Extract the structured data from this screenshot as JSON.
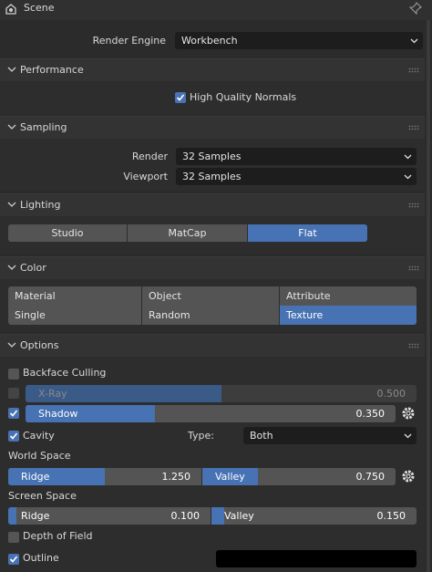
{
  "header": {
    "title": "Scene"
  },
  "render_engine": {
    "label": "Render Engine",
    "value": "Workbench"
  },
  "performance": {
    "title": "Performance",
    "high_quality_normals": {
      "label": "High Quality Normals",
      "checked": true
    }
  },
  "sampling": {
    "title": "Sampling",
    "render": {
      "label": "Render",
      "value": "32 Samples"
    },
    "viewport": {
      "label": "Viewport",
      "value": "32 Samples"
    }
  },
  "lighting": {
    "title": "Lighting",
    "options": [
      "Studio",
      "MatCap",
      "Flat"
    ],
    "selected": "Flat"
  },
  "color": {
    "title": "Color",
    "row1": [
      "Material",
      "Object",
      "Attribute"
    ],
    "row2": [
      "Single",
      "Random",
      "Texture"
    ],
    "selected": "Texture"
  },
  "options": {
    "title": "Options",
    "backface_culling": {
      "label": "Backface Culling",
      "checked": false
    },
    "xray": {
      "label": "X-Ray",
      "value": "0.500",
      "fraction": 0.5,
      "enabled": false
    },
    "shadow": {
      "label": "Shadow",
      "value": "0.350",
      "fraction": 0.35,
      "enabled": true
    },
    "cavity": {
      "label": "Cavity",
      "checked": true,
      "type_label": "Type:",
      "type_value": "Both"
    },
    "world_space": {
      "label": "World Space",
      "ridge": {
        "label": "Ridge",
        "value": "1.250",
        "fraction": 0.5
      },
      "valley": {
        "label": "Valley",
        "value": "0.750",
        "fraction": 0.29
      }
    },
    "screen_space": {
      "label": "Screen Space",
      "ridge": {
        "label": "Ridge",
        "value": "0.100",
        "fraction": 0.03
      },
      "valley": {
        "label": "Valley",
        "value": "0.150",
        "fraction": 0.06
      }
    },
    "depth_of_field": {
      "label": "Depth of Field",
      "checked": false
    },
    "outline": {
      "label": "Outline",
      "checked": true,
      "color": "#000000"
    }
  },
  "colors": {
    "accent": "#4772b3",
    "panel": "#2d2d2d",
    "field": "#545454"
  }
}
